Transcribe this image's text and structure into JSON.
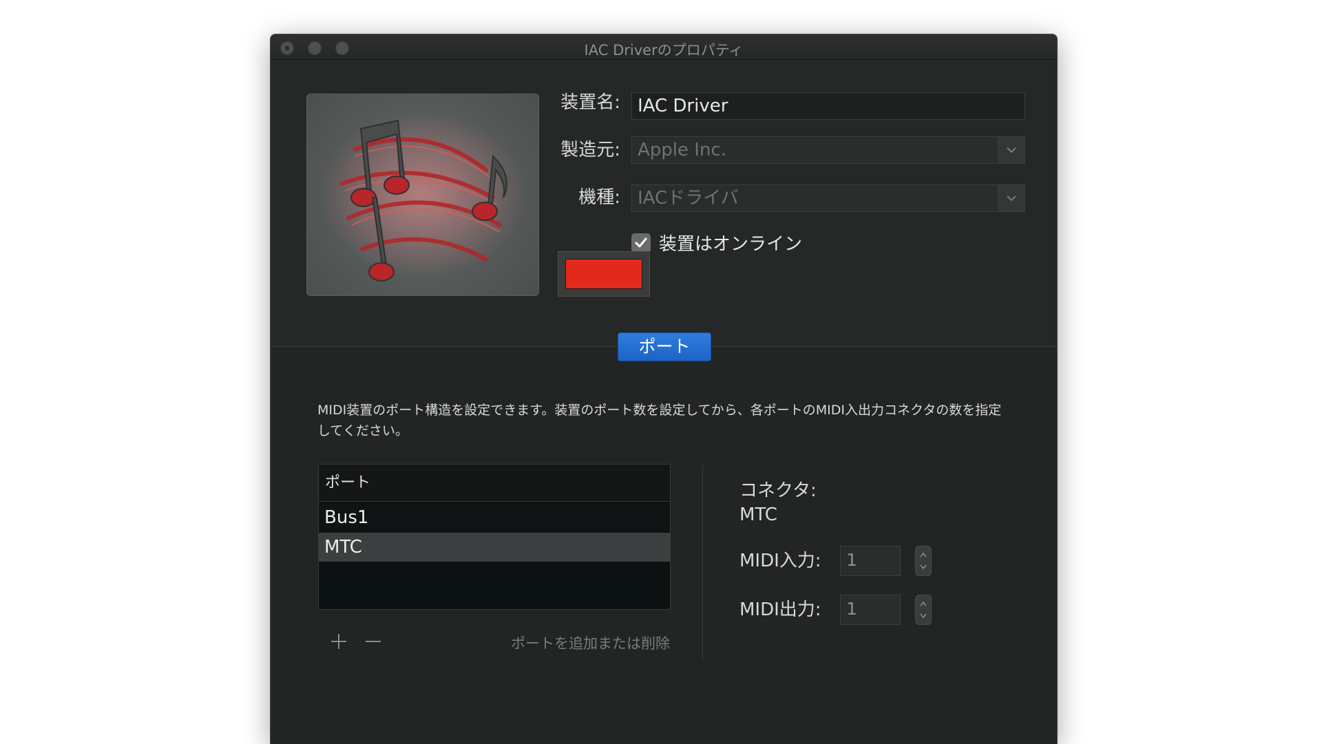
{
  "window": {
    "title": "IAC Driverのプロパティ"
  },
  "device": {
    "name_label": "装置名:",
    "name_value": "IAC Driver",
    "manufacturer_label": "製造元:",
    "manufacturer_value": "Apple Inc.",
    "model_label": "機種:",
    "model_value": "IACドライバ",
    "online_label": "装置はオンライン",
    "online_checked": true,
    "color": "#e3291b",
    "icon": "midi-notes-icon"
  },
  "tab": {
    "label": "ポート"
  },
  "ports": {
    "description": "MIDI装置のポート構造を設定できます。装置のポート数を設定してから、各ポートのMIDI入出力コネクタの数を指定してください。",
    "column_header": "ポート",
    "rows": [
      "Bus1",
      "MTC"
    ],
    "selected_index": 1,
    "add_icon": "plus-icon",
    "remove_icon": "minus-icon",
    "add_remove_label": "ポートを追加または削除"
  },
  "connector": {
    "title": "コネクタ:",
    "name": "MTC",
    "midi_in_label": "MIDI入力:",
    "midi_in_value": "1",
    "midi_out_label": "MIDI出力:",
    "midi_out_value": "1"
  },
  "colors": {
    "accent": "#1d63c4",
    "window_bg": "#262828"
  }
}
